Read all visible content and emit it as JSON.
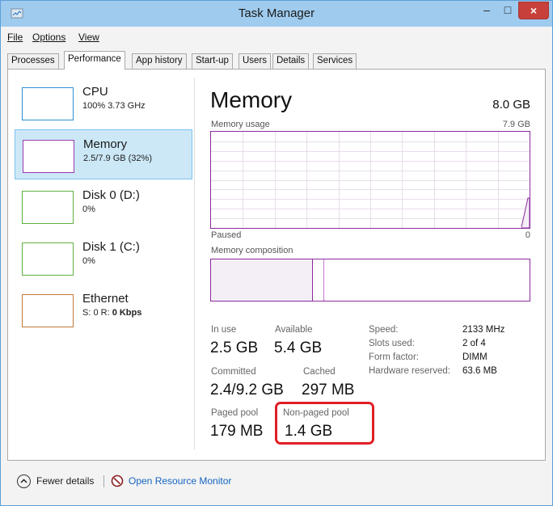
{
  "window": {
    "title": "Task Manager",
    "minimize": "–",
    "maximize": "□",
    "close": "×"
  },
  "menu": [
    {
      "id": "file",
      "label": "File"
    },
    {
      "id": "options",
      "label": "Options"
    },
    {
      "id": "view",
      "label": "View"
    }
  ],
  "tabs": [
    {
      "id": "processes",
      "label": "Processes"
    },
    {
      "id": "performance",
      "label": "Performance",
      "active": true
    },
    {
      "id": "app-history",
      "label": "App history"
    },
    {
      "id": "startup",
      "label": "Start-up"
    },
    {
      "id": "users",
      "label": "Users"
    },
    {
      "id": "details",
      "label": "Details"
    },
    {
      "id": "services",
      "label": "Services"
    }
  ],
  "sidebar": {
    "cpu": {
      "name": "CPU",
      "sub": "100% 3.73 GHz"
    },
    "memory": {
      "name": "Memory",
      "sub": "2.5/7.9 GB (32%)"
    },
    "disk0": {
      "name": "Disk 0 (D:)",
      "sub": "0%"
    },
    "disk1": {
      "name": "Disk 1 (C:)",
      "sub": "0%"
    },
    "ethernet": {
      "name": "Ethernet",
      "sub_prefix": "S: 0 R: ",
      "sub_bold": "0 Kbps"
    }
  },
  "main": {
    "title": "Memory",
    "total": "8.0 GB",
    "usage_label": "Memory usage",
    "usage_max": "7.9 GB",
    "graph_left_label": "Paused",
    "graph_right_label": "0",
    "composition_label": "Memory composition",
    "composition": {
      "in_use_fraction": 0.32,
      "modified_fraction": 0.035
    }
  },
  "stats": {
    "in_use": {
      "label": "In use",
      "value": "2.5 GB"
    },
    "available": {
      "label": "Available",
      "value": "5.4 GB"
    },
    "committed": {
      "label": "Committed",
      "value": "2.4/9.2 GB"
    },
    "cached": {
      "label": "Cached",
      "value": "297 MB"
    },
    "paged_pool": {
      "label": "Paged pool",
      "value": "179 MB"
    },
    "non_paged_pool": {
      "label": "Non-paged pool",
      "value": "1.4 GB"
    }
  },
  "hardware": {
    "speed": {
      "label": "Speed:",
      "value": "2133 MHz"
    },
    "slots_used": {
      "label": "Slots used:",
      "value": "2 of 4"
    },
    "form_factor": {
      "label": "Form factor:",
      "value": "DIMM"
    },
    "hardware_reserved": {
      "label": "Hardware reserved:",
      "value": "63.6 MB"
    }
  },
  "footer": {
    "fewer_details": "Fewer details",
    "open_resource_monitor": "Open Resource Monitor"
  },
  "colors": {
    "memory_accent": "#8c2a9e",
    "link": "#1565c0",
    "highlight": "#e01e25",
    "selection": "#cce8f7"
  }
}
